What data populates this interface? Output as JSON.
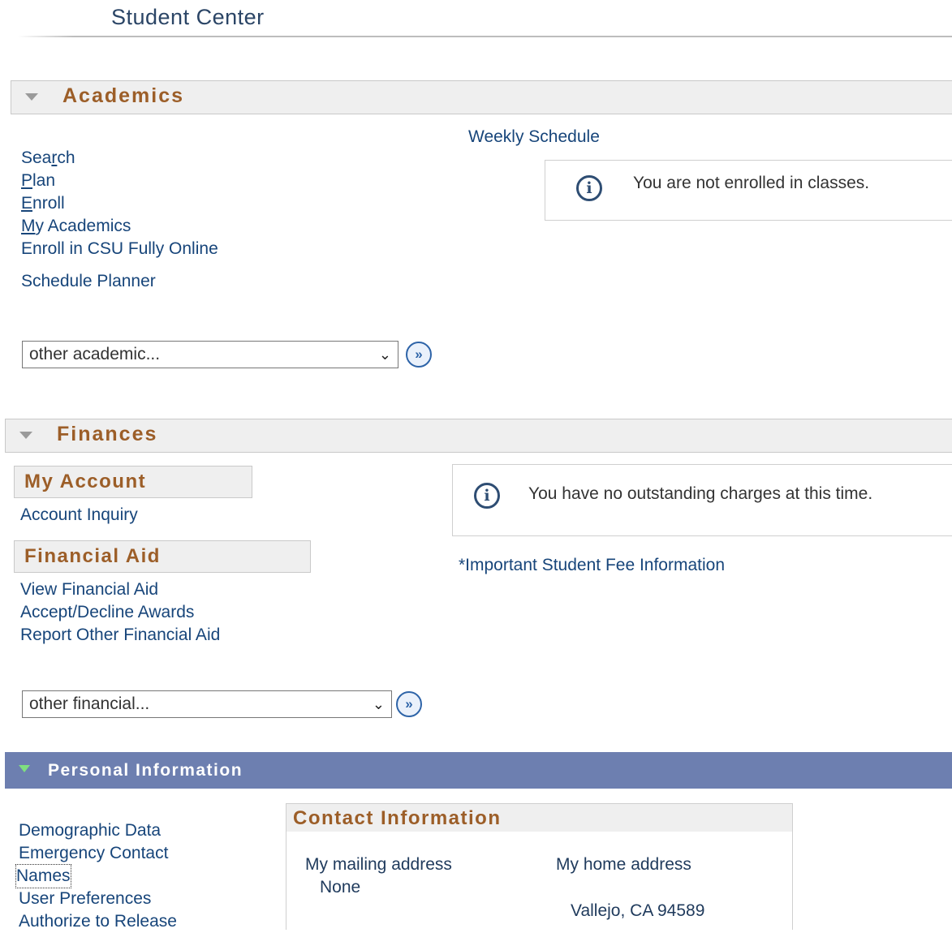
{
  "page": {
    "title": "Student Center"
  },
  "academics": {
    "header": "Academics",
    "links": [
      {
        "label_pre": "Sea",
        "label_ul": "r",
        "label_post": "ch"
      },
      {
        "label_pre": "",
        "label_ul": "P",
        "label_post": "lan"
      },
      {
        "label_pre": "",
        "label_ul": "E",
        "label_post": "nroll"
      },
      {
        "label_pre": "",
        "label_ul": "M",
        "label_post": "y Academics"
      },
      {
        "label_pre": "Enroll in CSU Fully Online",
        "label_ul": "",
        "label_post": ""
      }
    ],
    "schedule_planner": "Schedule Planner",
    "weekly_schedule": "Weekly Schedule",
    "notice": "You are not enrolled in classes.",
    "select_value": "other academic...",
    "go_label": "»"
  },
  "finances": {
    "header": "Finances",
    "my_account_header": "My Account",
    "account_inquiry": "Account Inquiry",
    "financial_aid_header": "Financial Aid",
    "aid_links": [
      "View Financial Aid",
      "Accept/Decline Awards",
      "Report Other Financial Aid"
    ],
    "notice": "You have no outstanding charges at this time.",
    "fee_info": "*Important Student Fee Information",
    "select_value": "other financial...",
    "go_label": "»"
  },
  "personal": {
    "header": "Personal Information",
    "links": [
      "Demographic Data",
      "Emergency Contact",
      "Names",
      "User Preferences",
      "Authorize to Release"
    ],
    "contact_header": "Contact Information",
    "mailing_label": "My mailing address",
    "mailing_value": "None",
    "home_label": "My home address",
    "home_value": "Vallejo, CA 94589"
  },
  "icons": {
    "info": "info-icon",
    "chevron": "chevron-down-icon",
    "go": "go-arrow-icon",
    "collapse": "collapse-triangle-icon"
  }
}
